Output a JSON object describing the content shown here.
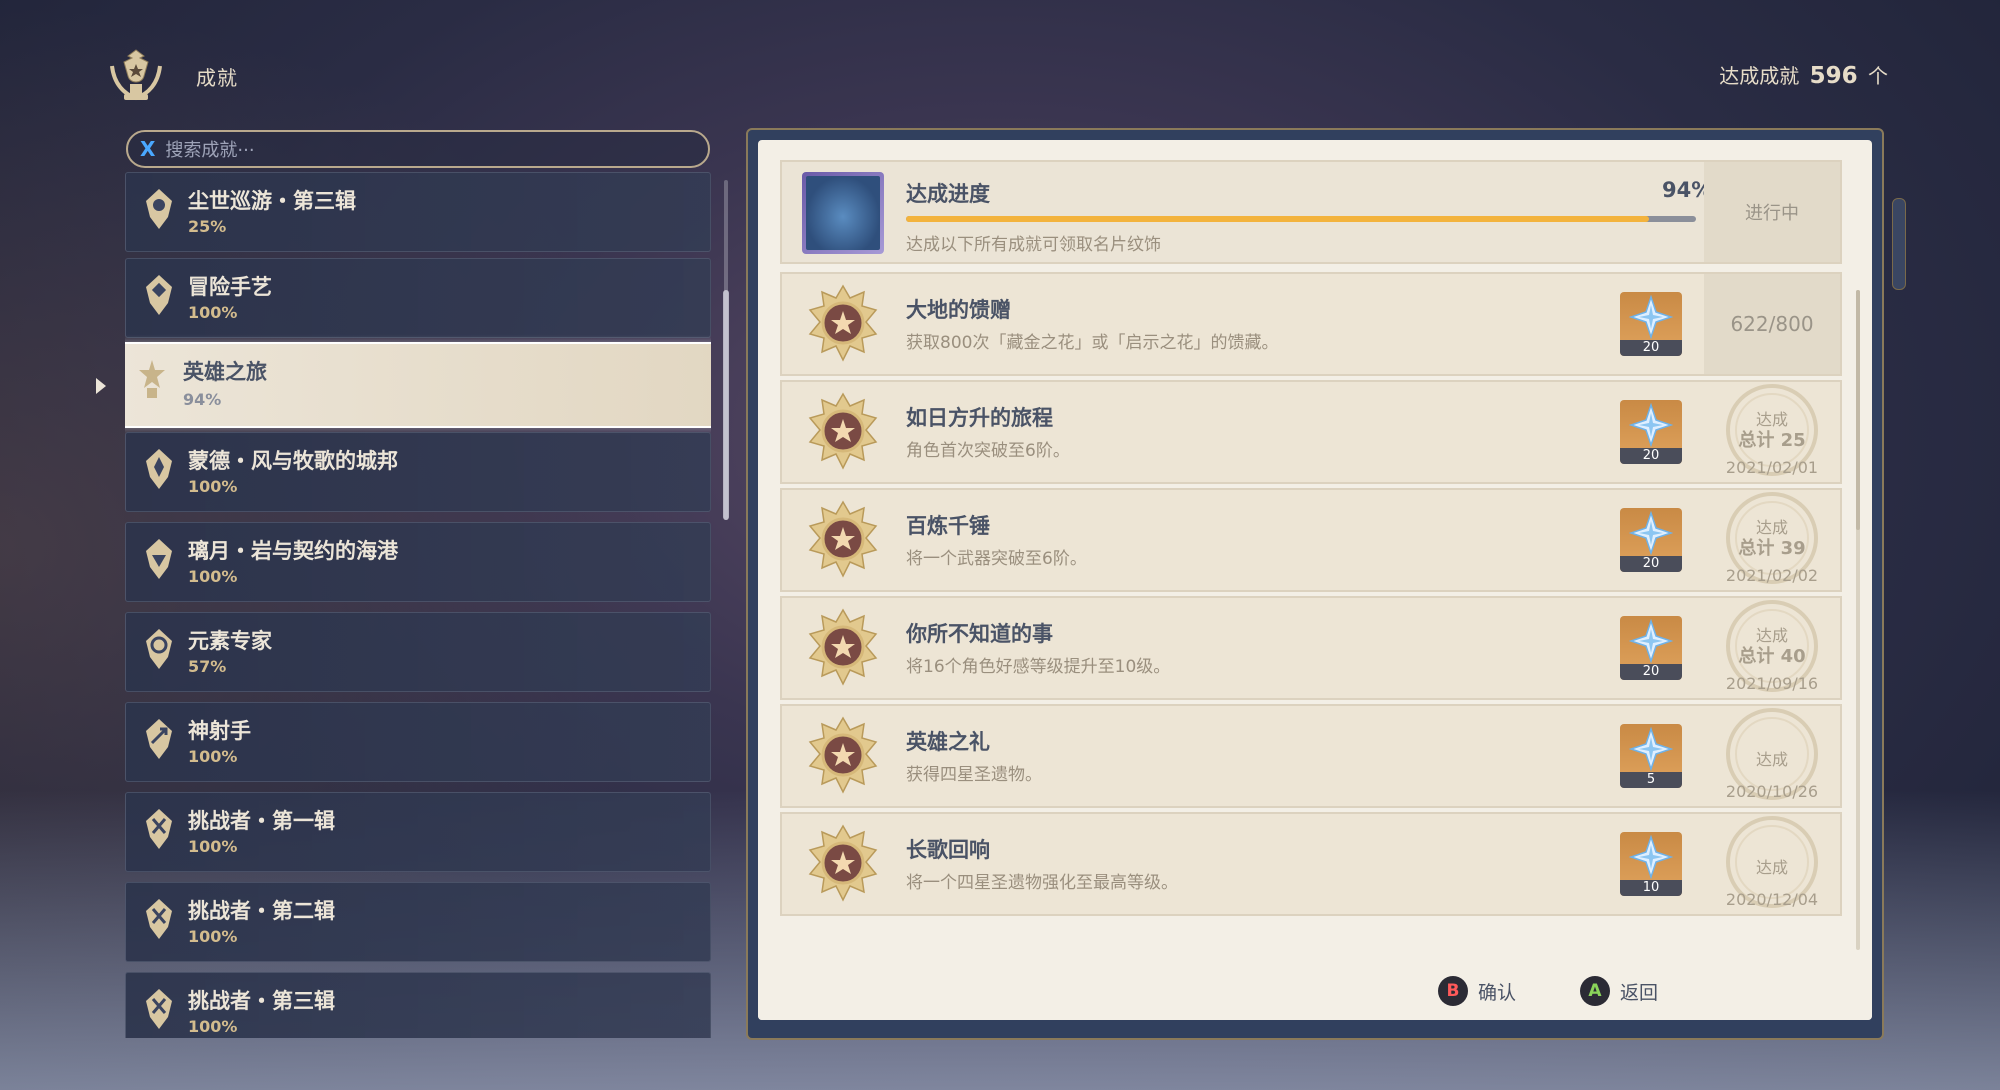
{
  "header": {
    "title": "成就",
    "total_prefix": "达成成就",
    "total_count": "596",
    "total_suffix": "个"
  },
  "search": {
    "key": "X",
    "placeholder": "搜索成就···"
  },
  "categories": [
    {
      "name": "尘世巡游・第三辑",
      "pct": "25%"
    },
    {
      "name": "冒险手艺",
      "pct": "100%"
    },
    {
      "name": "英雄之旅",
      "pct": "94%",
      "active": true
    },
    {
      "name": "蒙德・风与牧歌的城邦",
      "pct": "100%"
    },
    {
      "name": "璃月・岩与契约的海港",
      "pct": "100%"
    },
    {
      "name": "元素专家",
      "pct": "57%"
    },
    {
      "name": "神射手",
      "pct": "100%"
    },
    {
      "name": "挑战者・第一辑",
      "pct": "100%"
    },
    {
      "name": "挑战者・第二辑",
      "pct": "100%"
    },
    {
      "name": "挑战者・第三辑",
      "pct": "100%"
    }
  ],
  "progress": {
    "title": "达成进度",
    "percent_text": "94%",
    "percent_value": 94,
    "subtitle": "达成以下所有成就可领取名片纹饰",
    "status": "进行中"
  },
  "achievements": [
    {
      "title": "大地的馈赠",
      "desc": "获取800次「藏金之花」或「启示之花」的馈藏。",
      "reward": "20",
      "count": "622/800"
    },
    {
      "title": "如日方升的旅程",
      "desc": "角色首次突破至6阶。",
      "reward": "20",
      "stamp_l1": "达成",
      "stamp_l2": "总计 25",
      "stamp_date": "2021/02/01"
    },
    {
      "title": "百炼千锤",
      "desc": "将一个武器突破至6阶。",
      "reward": "20",
      "stamp_l1": "达成",
      "stamp_l2": "总计 39",
      "stamp_date": "2021/02/02"
    },
    {
      "title": "你所不知道的事",
      "desc": "将16个角色好感等级提升至10级。",
      "reward": "20",
      "stamp_l1": "达成",
      "stamp_l2": "总计 40",
      "stamp_date": "2021/09/16"
    },
    {
      "title": "英雄之礼",
      "desc": "获得四星圣遗物。",
      "reward": "5",
      "stamp_l1": "达成",
      "stamp_date": "2020/10/26"
    },
    {
      "title": "长歌回响",
      "desc": "将一个四星圣遗物强化至最高等级。",
      "reward": "10",
      "stamp_l1": "达成",
      "stamp_date": "2020/12/04"
    }
  ],
  "footer": {
    "confirm_key": "B",
    "confirm_label": "确认",
    "back_key": "A",
    "back_label": "返回"
  },
  "colors": {
    "accent_gold": "#f3b33d",
    "key_b": "#ff5a5a",
    "key_a": "#8ad45a",
    "key_x": "#4aa8ff"
  }
}
